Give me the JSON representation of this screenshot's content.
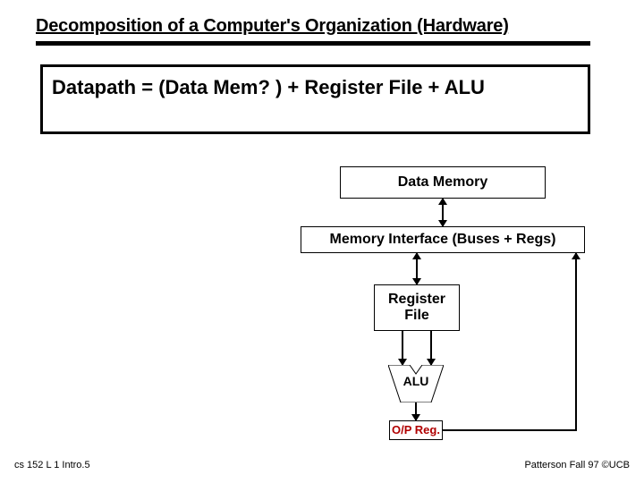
{
  "title": "Decomposition of a Computer's Organization (Hardware)",
  "formula": "Datapath = (Data Mem? ) + Register File + ALU",
  "boxes": {
    "data_memory": "Data Memory",
    "memory_interface": "Memory Interface (Buses + Regs)",
    "register_file": "Register\nFile",
    "alu": "ALU",
    "op_reg": "O/P Reg."
  },
  "footer": {
    "left": "cs 152  L 1 Intro.5",
    "right": "Patterson Fall 97 ©UCB"
  }
}
